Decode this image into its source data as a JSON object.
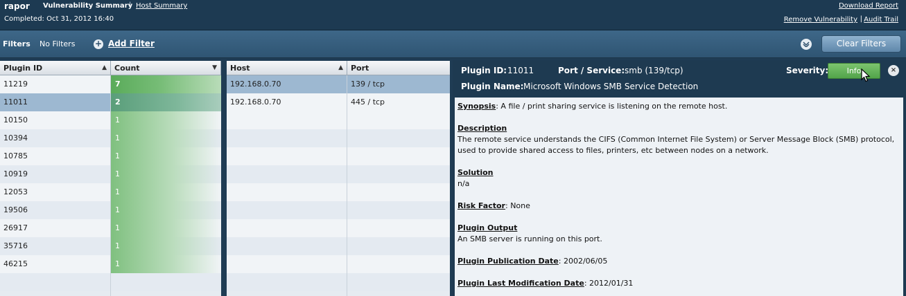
{
  "header": {
    "report_name": "rapor",
    "nav_vulnerability_summary": "Vulnerability Summary",
    "nav_separator": "|",
    "nav_host_summary": "Host Summary",
    "completed": "Completed: Oct 31, 2012 16:40",
    "download_report": "Download Report",
    "remove_vulnerability": "Remove Vulnerability",
    "link_separator": "|",
    "audit_trail": "Audit Trail"
  },
  "filters": {
    "label": "Filters",
    "status": "No Filters",
    "add_icon": "+",
    "add_filter": "Add Filter",
    "collapse_icon": "chevron-down-icon",
    "clear_filters": "Clear Filters"
  },
  "plugin_table": {
    "col_plugin_id": "Plugin ID",
    "col_count": "Count",
    "sort_up": "▲",
    "sort_down": "▼",
    "rows": [
      {
        "id": "11219",
        "count": "7"
      },
      {
        "id": "11011",
        "count": "2"
      },
      {
        "id": "10150",
        "count": "1"
      },
      {
        "id": "10394",
        "count": "1"
      },
      {
        "id": "10785",
        "count": "1"
      },
      {
        "id": "10919",
        "count": "1"
      },
      {
        "id": "12053",
        "count": "1"
      },
      {
        "id": "19506",
        "count": "1"
      },
      {
        "id": "26917",
        "count": "1"
      },
      {
        "id": "35716",
        "count": "1"
      },
      {
        "id": "46215",
        "count": "1"
      }
    ]
  },
  "host_table": {
    "col_host": "Host",
    "col_port": "Port",
    "sort_up": "▲",
    "rows": [
      {
        "host": "192.168.0.70",
        "port": "139 / tcp"
      },
      {
        "host": "192.168.0.70",
        "port": "445 / tcp"
      }
    ]
  },
  "detail": {
    "plugin_id_label": "Plugin ID:",
    "plugin_id": "11011",
    "port_service_label": "Port / Service:",
    "port_service": "smb (139/tcp)",
    "plugin_name_label": "Plugin Name:",
    "plugin_name": "Microsoft Windows SMB Service Detection",
    "severity_label": "Severity:",
    "severity": "Info",
    "severity_color": "#5cae52",
    "close_icon": "×",
    "synopsis_label": "Synopsis",
    "synopsis": ": A file / print sharing service is listening on the remote host.",
    "description_label": "Description",
    "description": "The remote service understands the CIFS (Common Internet File System) or Server Message Block (SMB) protocol, used to provide shared access to files, printers, etc between nodes on a network.",
    "solution_label": "Solution",
    "solution": "n/a",
    "risk_factor_label": "Risk Factor",
    "risk_factor": ": None",
    "plugin_output_label": "Plugin Output",
    "plugin_output": "An SMB server is running on this port.",
    "publication_date_label": "Plugin Publication Date",
    "publication_date": ": 2002/06/05",
    "modification_date_label": "Plugin Last Modification Date",
    "modification_date": ": 2012/01/31"
  }
}
